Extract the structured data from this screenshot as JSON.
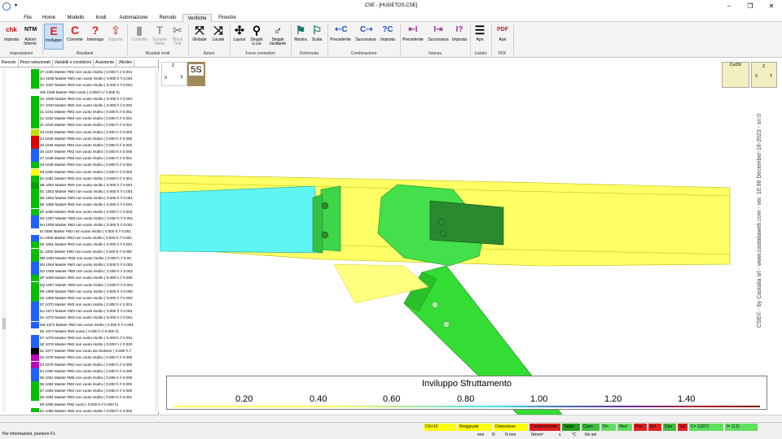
{
  "window": {
    "title": "CSE - [HUGETOS.CSE]",
    "logo_caption": "CSE",
    "minimize": "–",
    "maximize": "❐",
    "close": "✕"
  },
  "menu": {
    "tabs": [
      "File",
      "Home",
      "Modello",
      "Inodi",
      "Automazione",
      "Renodo",
      "Verifiche",
      "Finestre"
    ],
    "active": "Verifiche"
  },
  "ribbon": {
    "buttons": [
      {
        "label": "Imposta",
        "icon": "chk",
        "color": "#b01010"
      },
      {
        "label": "Azioni Interne",
        "icon": "NTM",
        "color": "#222222"
      },
      {
        "label": "Inviluppo",
        "icon": "E",
        "color": "#e02020"
      },
      {
        "label": "Corrente",
        "icon": "C",
        "color": "#e02020"
      },
      {
        "label": "Interroga",
        "icon": "?",
        "color": "#e02020"
      },
      {
        "label": "Esporta",
        "icon": "⇪",
        "color": "#c08080"
      },
      {
        "label": "Contratto",
        "icon": "▮",
        "color": "#999999"
      },
      {
        "label": "Sezione Netta",
        "icon": "T",
        "color": "#999999"
      },
      {
        "label": "Block Tear",
        "icon": "✂",
        "color": "#999999"
      },
      {
        "label": "Globale",
        "icon": "⤧",
        "color": "#333333"
      },
      {
        "label": "Locale",
        "icon": "⤨",
        "color": "#333333"
      },
      {
        "label": "Layout",
        "icon": "✣",
        "color": "#333333"
      },
      {
        "label": "Singoli u,v,w",
        "icon": "⚲",
        "color": "#333333"
      },
      {
        "label": "Singoli risultante",
        "icon": "♂",
        "color": "#333333"
      },
      {
        "label": "Mostra",
        "icon": "⚑",
        "color": "#1a7a6a"
      },
      {
        "label": "Scala",
        "icon": "⚐",
        "color": "#1a7a6a"
      },
      {
        "label": "Precedente",
        "icon": "⇠C",
        "color": "#2050c0"
      },
      {
        "label": "Successiva",
        "icon": "C⇢",
        "color": "#2050c0"
      },
      {
        "label": "Imposta",
        "icon": "?C",
        "color": "#2050c0"
      },
      {
        "label": "Precedente",
        "icon": "⇤I",
        "color": "#a030a0"
      },
      {
        "label": "Successiva",
        "icon": "I⇥",
        "color": "#a030a0"
      },
      {
        "label": "Imposta",
        "icon": "I?",
        "color": "#a030a0"
      },
      {
        "label": "Apri",
        "icon": "☰",
        "color": "#444444"
      },
      {
        "label": "Apri",
        "icon": "PDF",
        "color": "#c02020"
      }
    ],
    "groups": [
      "Impostazioni",
      "Risultanti",
      "Risultati modi",
      "Azioni",
      "Forze connettori",
      "Deformata",
      "Combinazione",
      "Istanza",
      "Listato",
      "PDF"
    ]
  },
  "panel": {
    "tabs": [
      "Renodo",
      "Pezzi selezionati",
      "Variabili e condizioni",
      "Assistente",
      "JNodex"
    ],
    "rows": [
      {
        "text": "4T 1035 Master #M2 non vuoto risolto ( 0.000 h // 0.001",
        "color": "#00c000"
      },
      {
        "text": "4U 1036 Master #M3 non vuoto risolto ( 0.000 h // 0.001",
        "color": "#00c000"
      },
      {
        "text": "4V 1037 Master #M3 non vuoto risolto ( 0.000 h // 0.001",
        "color": "#00c000"
      },
      {
        "text": "4W 1038 Master #M2 vuoto ( 0.000 h // 0.000 h)",
        "color": "#ffffff"
      },
      {
        "text": "4X 1039 Master #M3 non vuoto risolto ( 0.000 h // 0.001",
        "color": "#00c000"
      },
      {
        "text": "4Y 1040 Master #M3 non vuoto risolto ( 0.000 h // 0.001",
        "color": "#00c000"
      },
      {
        "text": "41 1041 Master #M3 non vuoto risolto ( 0.000 h // 0.001",
        "color": "#00c000"
      },
      {
        "text": "41 1042 Master #M3 non vuoto risolto ( 0.000 h // 0.001",
        "color": "#00c000"
      },
      {
        "text": "41 1043 Master #M3 non vuoto risolto ( 0.000 h // 0.001",
        "color": "#00c000"
      },
      {
        "text": "43 1044 Master #M2 non vuoto risolto ( 0.000 h // 0.000",
        "color": "#c0e000"
      },
      {
        "text": "44 1045 Master #M5 non vuoto risolto ( 0.000 h // 0.005",
        "color": "#e00000"
      },
      {
        "text": "45 1046 Master #M4 non vuoto risolto ( 0.000 h // 0.002",
        "color": "#e00000"
      },
      {
        "text": "46 1047 Master #M2 non vuoto risolto ( 0.000 h // 0.000",
        "color": "#2060ff"
      },
      {
        "text": "47 1048 Master #M3 non vuoto risolto ( 0.000 h // 0.001",
        "color": "#2060ff"
      },
      {
        "text": "48 1049 Master #M3 non vuoto risolto ( 0.000 h // 0.001",
        "color": "#00c000"
      },
      {
        "text": "49 1050 Master #M2 non vuoto risolto ( 0.000 h // 0.000",
        "color": "#ffff00"
      },
      {
        "text": "5A 1051 Master #M3 non vuoto risolto ( 0.000 h // 0.001",
        "color": "#00c000"
      },
      {
        "text": "5B 1052 Master #M4 non vuoto risolto ( 0.000 h // 0.001",
        "color": "#00a000"
      },
      {
        "text": "5C 1053 Master #M3 non vuoto risolto ( 0.000 h // 0.001",
        "color": "#00c000"
      },
      {
        "text": "5D 1054 Master #M3 non vuoto risolto ( 0.005 h // 0.001",
        "color": "#00c000"
      },
      {
        "text": "5E 1055 Master #M2 non vuoto risolto ( 0.000 h // 0.001",
        "color": "#00c000"
      },
      {
        "text": "5F 1056 Master #M5 non vuoto risolto ( 0.000 h // 0.003",
        "color": "#00c000"
      },
      {
        "text": "5G 1057 Master #M3 non vuoto risolto ( 0.000 h // 0.001",
        "color": "#2060ff"
      },
      {
        "text": "5H 1058 Master #M3 non vuoto risolto ( 0.000 h // 0.001",
        "color": "#2060ff"
      },
      {
        "text": "5I 1059 Master #M2 non vuoto risolto ( 0.000 h // 0.001",
        "color": "#ffffff"
      },
      {
        "text": "5J 1060 Master #M3 non vuoto risolto ( 0.000 h // 0.001",
        "color": "#2060ff"
      },
      {
        "text": "5K 1061 Master #M3 non vuoto risolto ( 0.000 h // 0.001",
        "color": "#00c000"
      },
      {
        "text": "5L 1062 Master #M2 non vuoto risolto ( 0.000 h // 0.000",
        "color": "#00c000"
      },
      {
        "text": "5M 1063 Master #M3 non vuoto risolto ( 0.000 h // 0.00",
        "color": "#00c000"
      },
      {
        "text": "5N 1064 Master #M3 non vuoto risolto ( 0.000 h // 0.002",
        "color": "#2060ff"
      },
      {
        "text": "5O 1065 Master #M3 non vuoto risolto ( 0.000 h // 0.001",
        "color": "#2060ff"
      },
      {
        "text": "5P 1066 Master #M2 non vuoto risolto ( 0.000 h // 0.000",
        "color": "#00c000"
      },
      {
        "text": "5Q 1067 Master #M3 non vuoto risolto ( 0.000 h // 0.001",
        "color": "#00c000"
      },
      {
        "text": "5R 1068 Master #M2 non vuoto risolto ( 0.000 h // 0.000",
        "color": "#00c000"
      },
      {
        "text": "5S 1069 Master #M4 non vuoto risolto ( 0.000 h // 0.002",
        "color": "#00c000"
      },
      {
        "text": "5T 1070 Master #M3 non vuoto risolto ( 0.000 h // 0.001",
        "color": "#2060ff"
      },
      {
        "text": "5U 1071 Master #M3 non vuoto risolto ( 0.000 h // 0.001",
        "color": "#2060ff"
      },
      {
        "text": "5V 1072 Master #M3 non vuoto risolto ( 0.000 h // 0.001",
        "color": "#2060ff"
      },
      {
        "text": "5W 1073 Master #M3 non vuoto risolto ( 0.000 h // 0.001",
        "color": "#2060ff"
      },
      {
        "text": "5X 1074 Master #M4 vuoto ( 0.000 h // 0.000 h)",
        "color": "#ffffff"
      },
      {
        "text": "5Y 1075 Master #M3 non vuoto risolto ( 0.000 h // 0.001",
        "color": "#2060ff"
      },
      {
        "text": "5Z 1076 Master #M2 non vuoto risolto ( 0.000 h // 0.000",
        "color": "#2060ff"
      },
      {
        "text": "51 1077 Master #M6 non vuoto da risolvere ( 0.000 h //",
        "color": "#000000"
      },
      {
        "text": "52 1078 Master #M4 non vuoto risolto ( 0.000 h // 0.006",
        "color": "#c000c0"
      },
      {
        "text": "53 1079 Master #M2 non vuoto risolto ( 0.000 h // 0.000",
        "color": "#c000c0"
      },
      {
        "text": "54 1080 Master #M2 non vuoto risolto ( 0.000 h // 0.000",
        "color": "#2060ff"
      },
      {
        "text": "55 1081 Master #M5 non vuoto risolto ( 0.006 h // 0.009",
        "color": "#2060ff"
      },
      {
        "text": "56 1082 Master #M2 non vuoto risolto ( 0.000 h // 0.000",
        "color": "#00c000"
      },
      {
        "text": "57 1083 Master #M2 non vuoto risolto ( 0.000 h // 0.000",
        "color": "#00c000"
      },
      {
        "text": "58 1084 Master #M3 non vuoto risolto ( 0.000 h // 0.001",
        "color": "#00c000"
      },
      {
        "text": "59 1085 Master #M2 vuoto ( 0.000 h // 0.000 h)",
        "color": "#ffffff"
      },
      {
        "text": "5A 1086 Master #M4 non vuoto risolto ( 0.000 h // 0.002",
        "color": "#00c000"
      },
      {
        "text": "6B 1087 Master #M3 non vuoto risolto ( 0.000 h // 0.001",
        "color": "#00c000"
      }
    ]
  },
  "viewport": {
    "axes_top": "z",
    "axes_left": "x",
    "axes_right": "Y",
    "badge": "5S",
    "curdir_label": "CurDir",
    "zview_top": "Z",
    "zview_left": "X",
    "zview_right": "Y",
    "watermark": "CSE© - by Castalia srl - www.castaliaweb.com - ver. 10.98 December-18-2023 - sn:0",
    "legend": {
      "title": "Inviluppo Sfruttamento",
      "values": [
        "0.20",
        "0.40",
        "0.60",
        "0.80",
        "1.00",
        "1.20",
        "1.40"
      ]
    }
  },
  "status": {
    "help": "Per informazioni, premere F1",
    "cells": [
      {
        "text": "DS=10",
        "color": "#ffff00"
      },
      {
        "text": "Ringgiuste",
        "color": "#ffff00"
      },
      {
        "text": "Distorsione",
        "color": "#ffff00"
      },
      {
        "text": "Compressione",
        "color": "#e02020"
      },
      {
        "text": "Taglio",
        "color": "#20a020"
      },
      {
        "text": "Conn",
        "color": "#40c040"
      },
      {
        "text": "Fin",
        "color": "#60e060"
      },
      {
        "text": "Med",
        "color": "#60e060"
      },
      {
        "text": "Pos",
        "color": "#e02020"
      },
      {
        "text": "Bol",
        "color": "#e02020"
      },
      {
        "text": "Cen",
        "color": "#40c040"
      },
      {
        "text": "Sal",
        "color": "#e02020"
      },
      {
        "text": "C= 1(207)",
        "color": "#60e060"
      },
      {
        "text": "I= 1| 2)",
        "color": "#60e060"
      }
    ],
    "units": [
      "mm",
      "N",
      "N mm",
      "N/mm²",
      "s",
      "°C",
      "No sel"
    ]
  }
}
